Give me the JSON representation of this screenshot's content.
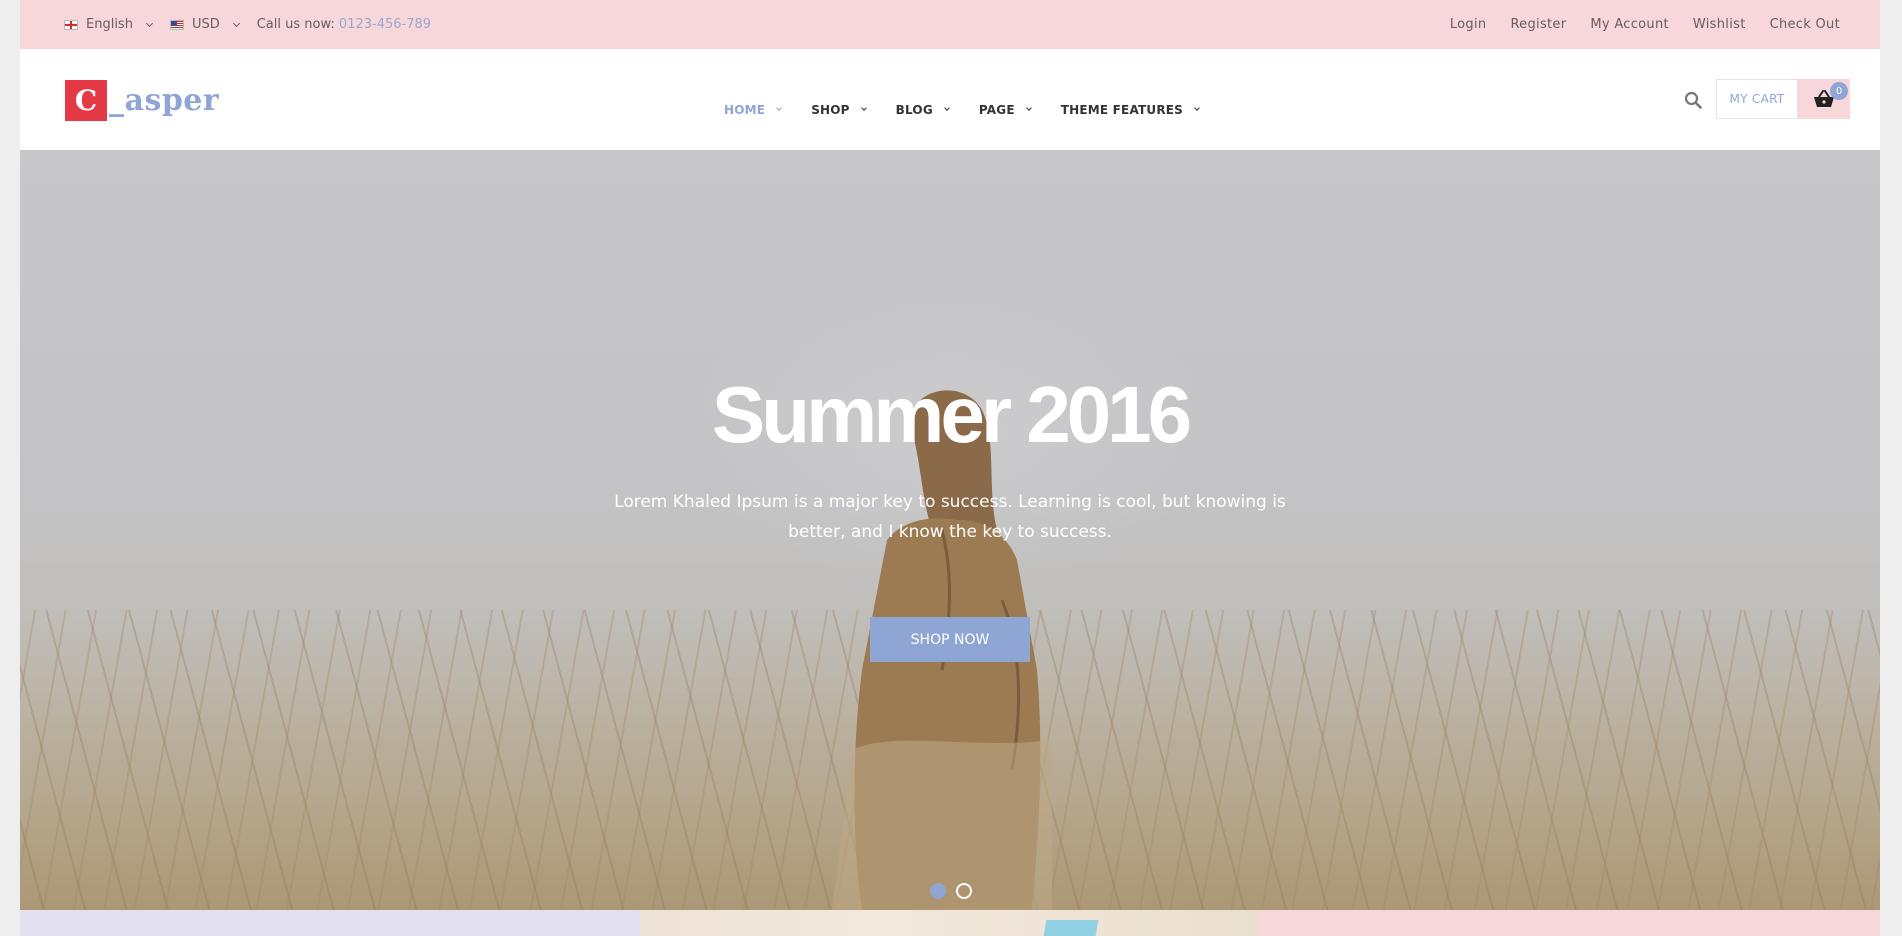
{
  "topbar": {
    "language": "English",
    "currency": "USD",
    "call_label": "Call us now:",
    "phone": "0123-456-789",
    "links": [
      "Login",
      "Register",
      "My Account",
      "Wishlist",
      "Check Out"
    ]
  },
  "header": {
    "logo_letter": "C",
    "logo_text": "_asper",
    "nav": [
      "HOME",
      "SHOP",
      "BLOG",
      "PAGE",
      "THEME FEATURES"
    ],
    "cart_label": "MY CART",
    "cart_count": "0"
  },
  "hero": {
    "title": "Summer 2016",
    "text": "Lorem Khaled Ipsum is a major key to success. Learning is cool, but knowing is better, and I know the key to success.",
    "button": "SHOP NOW",
    "slide_count": 2,
    "active_slide": 1
  },
  "colors": {
    "accent": "#8fa5d3",
    "topbar_bg": "#f8d7da",
    "logo_red": "#e63946"
  },
  "icons": [
    "uk-flag-icon",
    "us-flag-icon",
    "chevron-down-icon",
    "search-icon",
    "basket-icon"
  ]
}
